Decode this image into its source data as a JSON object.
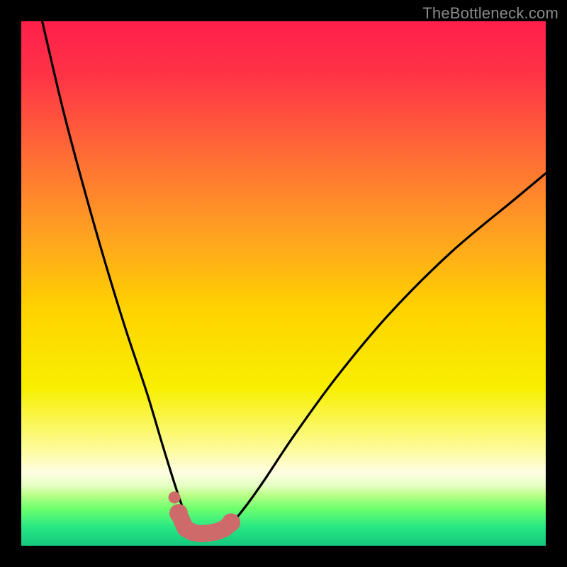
{
  "watermark": "TheBottleneck.com",
  "colors": {
    "frame": "#000000",
    "gradient_stops": [
      {
        "offset": 0.0,
        "color": "#ff1f4b"
      },
      {
        "offset": 0.1,
        "color": "#ff3246"
      },
      {
        "offset": 0.25,
        "color": "#ff6a36"
      },
      {
        "offset": 0.4,
        "color": "#ff9f22"
      },
      {
        "offset": 0.55,
        "color": "#ffd300"
      },
      {
        "offset": 0.7,
        "color": "#f8ef00"
      },
      {
        "offset": 0.82,
        "color": "#fdfca0"
      },
      {
        "offset": 0.86,
        "color": "#fefde2"
      },
      {
        "offset": 0.885,
        "color": "#e6ffc3"
      },
      {
        "offset": 0.905,
        "color": "#b6ff84"
      },
      {
        "offset": 0.93,
        "color": "#6bff6e"
      },
      {
        "offset": 0.965,
        "color": "#27e783"
      },
      {
        "offset": 1.0,
        "color": "#14c87f"
      }
    ],
    "curve": "#000000",
    "marker": "#cf6a6a"
  },
  "chart_data": {
    "type": "line",
    "title": "",
    "xlabel": "",
    "ylabel": "",
    "xlim": [
      0,
      100
    ],
    "ylim": [
      0,
      100
    ],
    "series": [
      {
        "name": "bottleneck-curve",
        "x": [
          4,
          8,
          12,
          16,
          20,
          24,
          27,
          29.5,
          31.5,
          33.5,
          36,
          39,
          42,
          46,
          52,
          60,
          70,
          82,
          94,
          100
        ],
        "y": [
          100,
          83,
          68,
          54,
          41,
          29,
          19,
          11,
          5.5,
          2.7,
          2.5,
          3.3,
          6.5,
          12,
          21,
          32,
          44,
          56,
          66,
          71
        ]
      }
    ],
    "markers": {
      "name": "optimum-band",
      "x": [
        30.0,
        31.3,
        32.8,
        34.3,
        35.8,
        37.3,
        38.8,
        40.0
      ],
      "y": [
        6.2,
        3.3,
        2.5,
        2.3,
        2.4,
        2.7,
        3.3,
        4.4
      ],
      "extra_dot": {
        "x": 29.2,
        "y": 9.2
      }
    }
  }
}
